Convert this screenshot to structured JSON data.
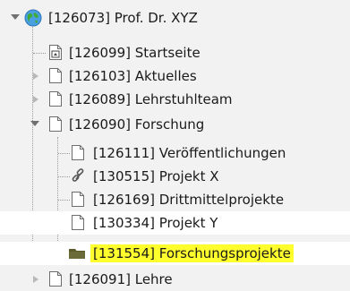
{
  "tree": {
    "root": {
      "label": "[126073] Prof. Dr. XYZ",
      "icon": "globe-icon",
      "expanded": true
    },
    "items": [
      {
        "label": "[126099] Startseite",
        "icon": "home-page-icon"
      },
      {
        "label": "[126103] Aktuelles",
        "icon": "page-icon",
        "expanded": false
      },
      {
        "label": "[126089] Lehrstuhlteam",
        "icon": "page-icon",
        "expanded": false
      },
      {
        "label": "[126090] Forschung",
        "icon": "page-icon",
        "expanded": true,
        "children": [
          {
            "label": "[126111] Veröffentlichungen",
            "icon": "page-icon"
          },
          {
            "label": "[130515] Projekt X",
            "icon": "link-icon"
          },
          {
            "label": "[126169] Drittmittelprojekte",
            "icon": "page-icon"
          },
          {
            "label": "[130334] Projekt Y",
            "icon": "page-icon"
          },
          {
            "label": "[131554] Forschungsprojekte",
            "icon": "folder-icon",
            "selected": true
          }
        ]
      },
      {
        "label": "[126091] Lehre",
        "icon": "page-icon",
        "expanded": false
      }
    ]
  },
  "colors": {
    "selection_highlight": "#ffff2e",
    "globe_blue": "#4a9fe0",
    "globe_green": "#3faa3a"
  }
}
